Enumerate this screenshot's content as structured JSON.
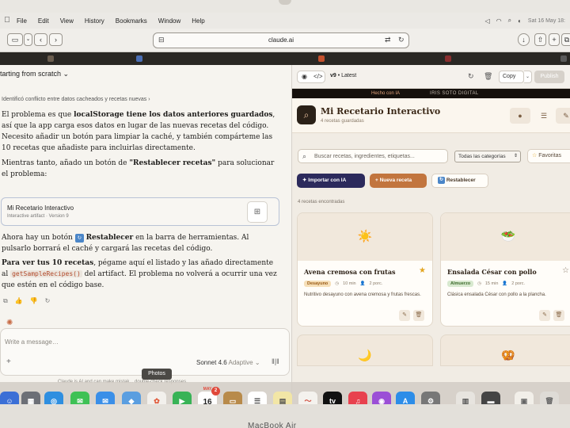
{
  "menubar": {
    "items": [
      "File",
      "Edit",
      "View",
      "History",
      "Bookmarks",
      "Window",
      "Help"
    ],
    "clock": "Sat 16 May 18:"
  },
  "browser": {
    "url": "claude.ai"
  },
  "chat": {
    "title": "tarting from scratch",
    "system_line": "Identificó conflicto entre datos cacheados y recetas nuevas",
    "para1_a": "El problema es que ",
    "para1_b": "localStorage tiene los datos anteriores guardados",
    "para1_c": ", así que la app carga esos datos en lugar de las nuevas recetas del código. Necesito añadir un botón para limpiar la caché, y también compárteme las 10 recetas que añadiste para incluirlas directamente.",
    "para2_a": "Mientras tanto, añado un botón de ",
    "para2_b": "\"Restablecer recetas\"",
    "para2_c": " para solucionar el problema:",
    "artifact_title": "Mi Recetario Interactivo",
    "artifact_sub": "Interactive artifact · Version 9",
    "para3_a": "Ahora hay un botón ",
    "para3_b": "Restablecer",
    "para3_c": " en la barra de herramientas. Al pulsarlo borrará el caché y cargará las recetas del código.",
    "para4_a": "Para ver tus 10 recetas",
    "para4_b": ", pégame aquí el listado y las añado directamente al ",
    "para4_code": "getSampleRecipes()",
    "para4_c": " del artifact. El problema no volverá a ocurrir una vez que estén en el código base.",
    "composer_placeholder": "Write a message…",
    "model": "Sonnet 4.6",
    "mode": "Adaptive",
    "disclaimer": "Claude is AI and can make mistak... double-check responses."
  },
  "artifact_bar": {
    "version": "v9",
    "latest": "Latest",
    "copy": "Copy",
    "publish": "Publish"
  },
  "promo": {
    "a": "Hecho con IA",
    "b": "IRIS SOTO DIGITAL"
  },
  "app": {
    "title": "Mi Recetario Interactivo",
    "subtitle": "4 recetas guardadas",
    "search_placeholder": "Buscar recetas, ingredientes, etiquetas...",
    "category": "Todas las categorías",
    "favorites": "Favoritas",
    "btn_import": "Importar con IA",
    "btn_new": "+ Nueva receta",
    "btn_reset": "Restablecer",
    "found": "4 recetas encontradas",
    "recipes": [
      {
        "title": "Avena cremosa con frutas",
        "badge": "Desayuno",
        "time": "10 min",
        "servings": "2 porc.",
        "desc": "Nutritivo desayuno con avena cremosa y frutas frescas.",
        "badge_color": "#f6dfb8",
        "badge_text": "#9a5b15",
        "favorite": true
      },
      {
        "title": "Ensalada César con pollo",
        "badge": "Almuerzo",
        "time": "15 min",
        "servings": "2 porc.",
        "desc": "Clásica ensalada César con pollo a la plancha.",
        "badge_color": "#d8e9cf",
        "badge_text": "#3e6b2c",
        "favorite": false
      }
    ]
  },
  "dock": {
    "tooltip": "Photos",
    "calendar_month": "MAY",
    "calendar_day": "16",
    "badge": "2"
  },
  "device": {
    "brand": "MacBook Air"
  },
  "colors": {
    "accent_orange": "#c2753e",
    "accent_navy": "#2c2a5c"
  }
}
